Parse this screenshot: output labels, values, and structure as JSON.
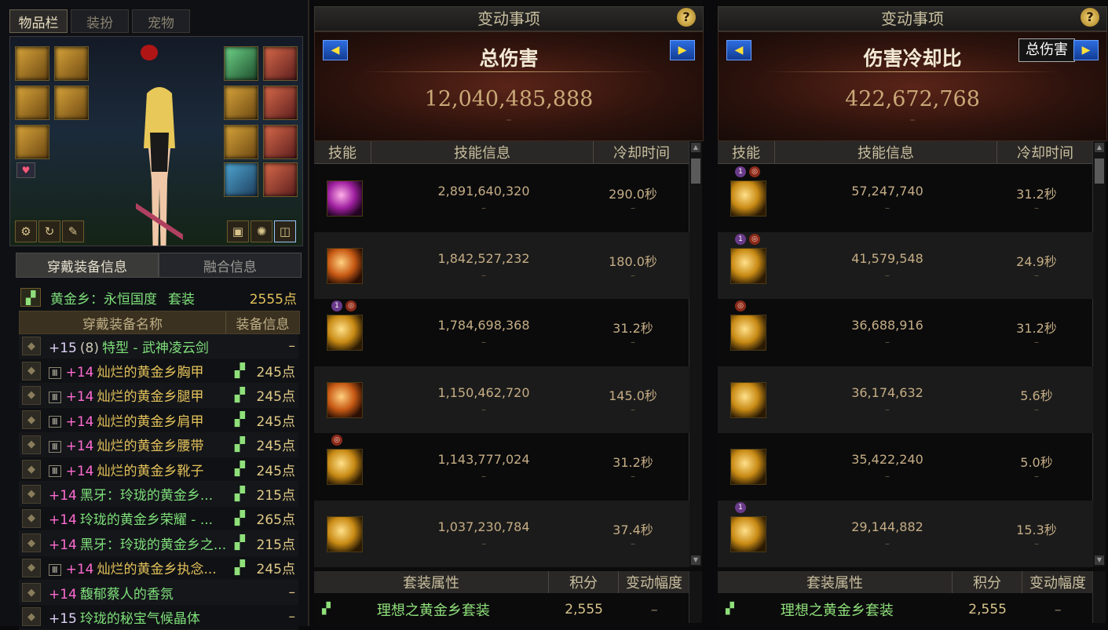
{
  "left": {
    "tabs": [
      "物品栏",
      "装扮",
      "宠物"
    ],
    "equip_tabs": [
      "穿戴装备信息",
      "融合信息"
    ],
    "set": {
      "name": "黄金乡：永恒国度",
      "type": "套装",
      "points": "2555点"
    },
    "table_headers": {
      "name": "穿戴装备名称",
      "info": "装备信息"
    },
    "items": [
      {
        "plus": "+15",
        "pre": "(8)",
        "name": "特型 - 武神凌云剑",
        "points": "–",
        "tag": "",
        "icon": "sword-icon",
        "set": false,
        "color": "green"
      },
      {
        "plus": "+14",
        "pre": "",
        "name": "灿烂的黄金乡胸甲",
        "points": "245点",
        "tag": "Ⅲ",
        "icon": "chest-icon",
        "set": true,
        "color": "yellow"
      },
      {
        "plus": "+14",
        "pre": "",
        "name": "灿烂的黄金乡腿甲",
        "points": "245点",
        "tag": "Ⅲ",
        "icon": "legs-icon",
        "set": true,
        "color": "yellow"
      },
      {
        "plus": "+14",
        "pre": "",
        "name": "灿烂的黄金乡肩甲",
        "points": "245点",
        "tag": "Ⅲ",
        "icon": "shoulder-icon",
        "set": true,
        "color": "yellow"
      },
      {
        "plus": "+14",
        "pre": "",
        "name": "灿烂的黄金乡腰带",
        "points": "245点",
        "tag": "Ⅲ",
        "icon": "belt-icon",
        "set": true,
        "color": "yellow"
      },
      {
        "plus": "+14",
        "pre": "",
        "name": "灿烂的黄金乡靴子",
        "points": "245点",
        "tag": "Ⅲ",
        "icon": "boots-icon",
        "set": true,
        "color": "yellow"
      },
      {
        "plus": "+14",
        "pre": "",
        "name": "黑牙：玲珑的黄金乡...",
        "points": "215点",
        "tag": "",
        "icon": "necklace-icon",
        "set": true,
        "color": "green"
      },
      {
        "plus": "+14",
        "pre": "",
        "name": "玲珑的黄金乡荣耀 - ...",
        "points": "265点",
        "tag": "",
        "icon": "bracelet-icon",
        "set": true,
        "color": "green"
      },
      {
        "plus": "+14",
        "pre": "",
        "name": "黑牙：玲珑的黄金乡之...",
        "points": "215点",
        "tag": "",
        "icon": "ring-icon",
        "set": true,
        "color": "green"
      },
      {
        "plus": "+14",
        "pre": "",
        "name": "灿烂的黄金乡执念...",
        "points": "245点",
        "tag": "Ⅲ",
        "icon": "support-icon",
        "set": true,
        "color": "yellow"
      },
      {
        "plus": "+14",
        "pre": "",
        "name": "馥郁蔡人的香氛",
        "points": "–",
        "tag": "",
        "icon": "magic-stone-icon",
        "set": false,
        "color": "green"
      },
      {
        "plus": "+15",
        "pre": "",
        "name": "玲珑的秘宝气候晶体",
        "points": "–",
        "tag": "",
        "icon": "earring-icon",
        "set": false,
        "color": "green"
      }
    ]
  },
  "panels": [
    {
      "title": "变动事项",
      "hero_title": "总伤害",
      "hero_value": "12,040,485,888",
      "hero_dash": "–",
      "total_button": "",
      "headers": [
        "技能",
        "技能信息",
        "冷却时间"
      ],
      "rows": [
        {
          "value": "2,891,640,320",
          "cd": "290.0秒",
          "icon": "pink",
          "badges": []
        },
        {
          "value": "1,842,527,232",
          "cd": "180.0秒",
          "icon": "orange",
          "badges": []
        },
        {
          "value": "1,784,698,368",
          "cd": "31.2秒",
          "icon": "gold",
          "badges": [
            "1",
            "◎"
          ]
        },
        {
          "value": "1,150,462,720",
          "cd": "145.0秒",
          "icon": "orange",
          "badges": []
        },
        {
          "value": "1,143,777,024",
          "cd": "31.2秒",
          "icon": "gold",
          "badges": [
            "◎"
          ]
        },
        {
          "value": "1,037,230,784",
          "cd": "37.4秒",
          "icon": "gold",
          "badges": []
        }
      ],
      "set_headers": [
        "套装属性",
        "积分",
        "变动幅度"
      ],
      "set_row": {
        "name": "理想之黄金乡套装",
        "score": "2,555",
        "change": "–"
      }
    },
    {
      "title": "变动事项",
      "hero_title": "伤害冷却比",
      "hero_value": "422,672,768",
      "hero_dash": "–",
      "total_button": "总伤害",
      "headers": [
        "技能",
        "技能信息",
        "冷却时间"
      ],
      "rows": [
        {
          "value": "57,247,740",
          "cd": "31.2秒",
          "icon": "gold",
          "badges": [
            "1",
            "◎"
          ]
        },
        {
          "value": "41,579,548",
          "cd": "24.9秒",
          "icon": "gold",
          "badges": [
            "1",
            "◎"
          ]
        },
        {
          "value": "36,688,916",
          "cd": "31.2秒",
          "icon": "gold",
          "badges": [
            "◎"
          ]
        },
        {
          "value": "36,174,632",
          "cd": "5.6秒",
          "icon": "gold",
          "badges": []
        },
        {
          "value": "35,422,240",
          "cd": "5.0秒",
          "icon": "gold",
          "badges": []
        },
        {
          "value": "29,144,882",
          "cd": "15.3秒",
          "icon": "gold",
          "badges": [
            "1"
          ]
        }
      ],
      "set_headers": [
        "套装属性",
        "积分",
        "变动幅度"
      ],
      "set_row": {
        "name": "理想之黄金乡套装",
        "score": "2,555",
        "change": "–"
      }
    }
  ],
  "help_label": "?",
  "arrow_left": "◀",
  "arrow_right": "▶",
  "colors": {
    "gold": "#e4c25a",
    "green": "#7fe07a",
    "pink": "#ff6bd1"
  }
}
